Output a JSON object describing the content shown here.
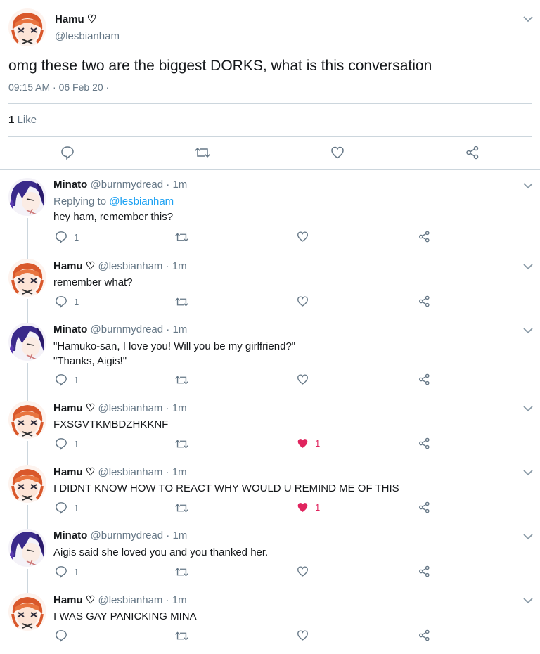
{
  "colors": {
    "accent": "#1da1f2",
    "like": "#e0245e",
    "muted": "#657786",
    "divider": "#ccd6dd"
  },
  "main_tweet": {
    "name": "Hamu ♡",
    "handle": "@lesbianham",
    "text": "omg these two are the biggest DORKS, what is this conversation",
    "timestamp": "09:15 AM · 06 Feb 20 ·",
    "likes_count": "1",
    "likes_label": "Like"
  },
  "replies": [
    {
      "name": "Minato",
      "handle": "@burnmydread",
      "time": "· 1m",
      "replying_prefix": "Replying to",
      "replying_to": "@lesbianham",
      "lines": [
        "hey ham, remember this?"
      ],
      "reply_count": "1",
      "like_count": "",
      "liked": false,
      "avatar": "minato"
    },
    {
      "name": "Hamu ♡",
      "handle": "@lesbianham",
      "time": "· 1m",
      "lines": [
        "remember what?"
      ],
      "reply_count": "1",
      "like_count": "",
      "liked": false,
      "avatar": "hamu"
    },
    {
      "name": "Minato",
      "handle": "@burnmydread",
      "time": "· 1m",
      "lines": [
        "\"Hamuko-san, I love you! Will you be my girlfriend?\"",
        "\"Thanks, Aigis!\""
      ],
      "reply_count": "1",
      "like_count": "",
      "liked": false,
      "avatar": "minato"
    },
    {
      "name": "Hamu ♡",
      "handle": "@lesbianham",
      "time": "· 1m",
      "lines": [
        "FXSGVTKMBDZHKKNF"
      ],
      "reply_count": "1",
      "like_count": "1",
      "liked": true,
      "avatar": "hamu"
    },
    {
      "name": "Hamu ♡",
      "handle": "@lesbianham",
      "time": "· 1m",
      "lines": [
        "I DIDNT KNOW HOW TO REACT WHY WOULD U REMIND ME OF THIS"
      ],
      "reply_count": "1",
      "like_count": "1",
      "liked": true,
      "avatar": "hamu"
    },
    {
      "name": "Minato",
      "handle": "@burnmydread",
      "time": "· 1m",
      "lines": [
        "Aigis said she loved you and you thanked her."
      ],
      "reply_count": "1",
      "like_count": "",
      "liked": false,
      "avatar": "minato"
    },
    {
      "name": "Hamu ♡",
      "handle": "@lesbianham",
      "time": "· 1m",
      "lines": [
        "I WAS GAY PANICKING MINA"
      ],
      "reply_count": "",
      "like_count": "",
      "liked": false,
      "avatar": "hamu"
    }
  ]
}
